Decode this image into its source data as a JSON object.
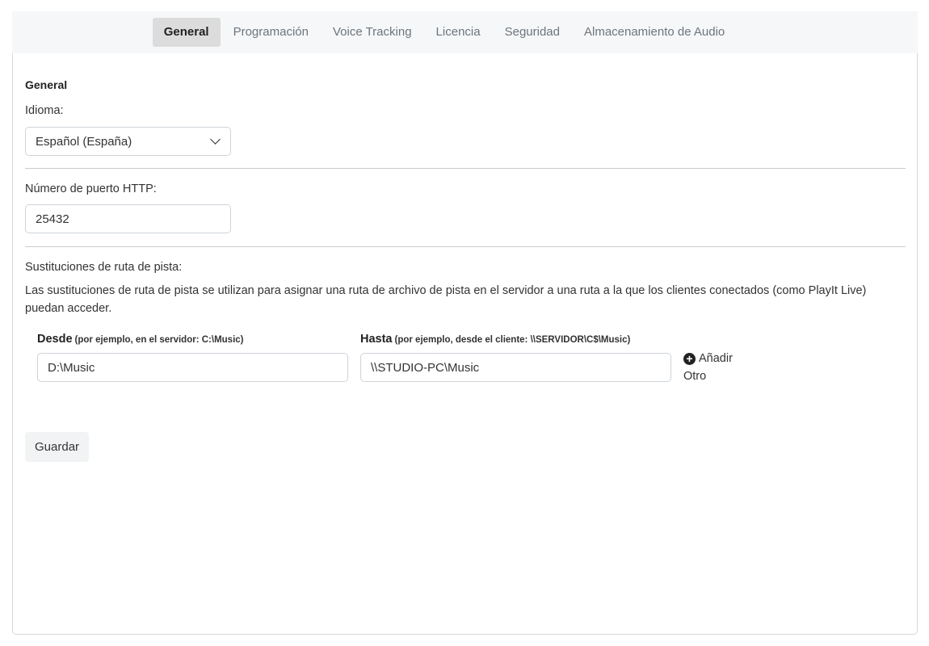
{
  "tabs": [
    {
      "label": "General",
      "active": true
    },
    {
      "label": "Programación"
    },
    {
      "label": "Voice Tracking"
    },
    {
      "label": "Licencia"
    },
    {
      "label": "Seguridad"
    },
    {
      "label": "Almacenamiento de Audio"
    }
  ],
  "general": {
    "section_title": "General",
    "language_label": "Idioma:",
    "language_value": "Español (España)"
  },
  "http": {
    "port_label": "Número de puerto HTTP:",
    "port_value": "25432"
  },
  "path_substitutions": {
    "label": "Sustituciones de ruta de pista:",
    "description": "Las sustituciones de ruta de pista se utilizan para asignar una ruta de archivo de pista en el servidor a una ruta a la que los clientes conectados (como PlayIt Live) puedan acceder.",
    "from_label": "Desde",
    "from_hint": "(por ejemplo, en el servidor: C:\\Music)",
    "from_value": "D:\\Music",
    "to_label": "Hasta",
    "to_hint": "(por ejemplo, desde el cliente: \\\\SERVIDOR\\C$\\Music)",
    "to_value": "\\\\STUDIO-PC\\Music",
    "add_line1": "Añadir",
    "add_line2": "Otro"
  },
  "actions": {
    "save_label": "Guardar"
  }
}
